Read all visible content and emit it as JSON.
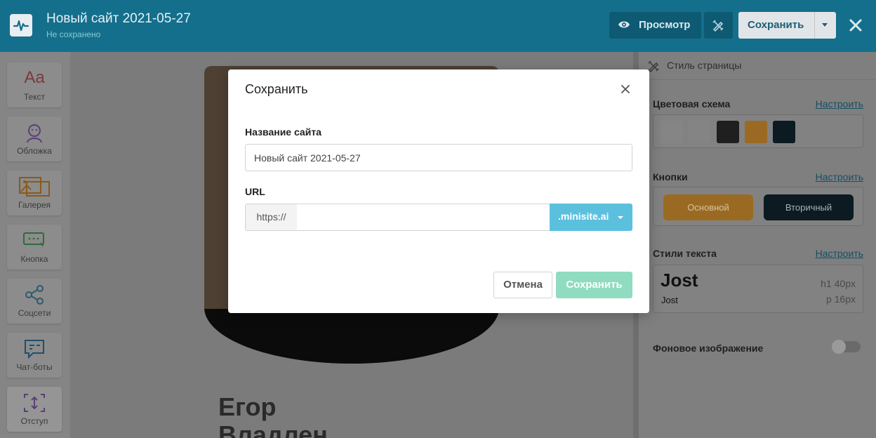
{
  "header": {
    "title": "Новый сайт 2021-05-27",
    "status": "Не сохранено",
    "preview_label": "Просмотр",
    "save_label": "Сохранить"
  },
  "left_tools": [
    {
      "label": "Текст",
      "icon": "text-aa-icon"
    },
    {
      "label": "Обложка",
      "icon": "cover-face-icon"
    },
    {
      "label": "Галерея",
      "icon": "gallery-icon"
    },
    {
      "label": "Кнопка",
      "icon": "button-icon"
    },
    {
      "label": "Соцсети",
      "icon": "share-icon"
    },
    {
      "label": "Чат-боты",
      "icon": "chat-icon"
    },
    {
      "label": "Отступ",
      "icon": "spacing-icon"
    }
  ],
  "canvas": {
    "name_line1": "Егор",
    "name_line2": "Владлен"
  },
  "right_panel": {
    "heading": "Стиль страницы",
    "color_scheme": {
      "title": "Цветовая схема",
      "link": "Настроить",
      "colors": [
        "#f5f5f5",
        "#e8e8e8",
        "#3a3a3a",
        "#e8962e",
        "#0f2430"
      ]
    },
    "buttons": {
      "title": "Кнопки",
      "link": "Настроить",
      "primary": "Основной",
      "secondary": "Вторичный"
    },
    "text_styles": {
      "title": "Стили текста",
      "link": "Настроить",
      "font_big": "Jost",
      "font_small": "Jost",
      "h1": "h1  40px",
      "p": "p  16px"
    },
    "background": {
      "title": "Фоновое изображение",
      "enabled": false
    }
  },
  "modal": {
    "title": "Сохранить",
    "site_name_label": "Название сайта",
    "site_name_value": "Новый сайт 2021-05-27",
    "url_label": "URL",
    "url_prefix": "https://",
    "url_value": "",
    "url_domain": ".minisite.ai",
    "cancel_label": "Отмена",
    "save_label": "Сохранить"
  },
  "colors": {
    "topbar": "#146f8c",
    "domain_button": "#5bc0de",
    "save_button": "#8fdcc0"
  }
}
